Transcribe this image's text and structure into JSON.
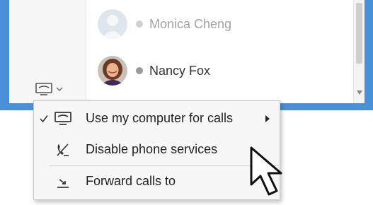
{
  "contacts": [
    {
      "name": "Monica Cheng",
      "status": "offline",
      "status_color": "#9a9a9a"
    },
    {
      "name": "Nancy Fox",
      "status": "offline",
      "status_color": "#9a9a9a"
    }
  ],
  "device_button": {
    "icon": "desk-phone-icon",
    "dropdown_icon": "chevron-down-icon"
  },
  "menu": {
    "items": [
      {
        "label": "Use my computer for calls",
        "icon": "computer-phone-icon",
        "checked": true,
        "has_submenu": true
      },
      {
        "label": "Disable phone services",
        "icon": "phone-disabled-icon",
        "checked": false,
        "has_submenu": false
      },
      {
        "label": "Forward calls to",
        "icon": "call-forward-icon",
        "checked": false,
        "has_submenu": false
      }
    ]
  },
  "colors": {
    "window_frame": "#4a90d9",
    "menu_background": "#f7f7f7",
    "presence_offline": "#9a9a9a"
  }
}
